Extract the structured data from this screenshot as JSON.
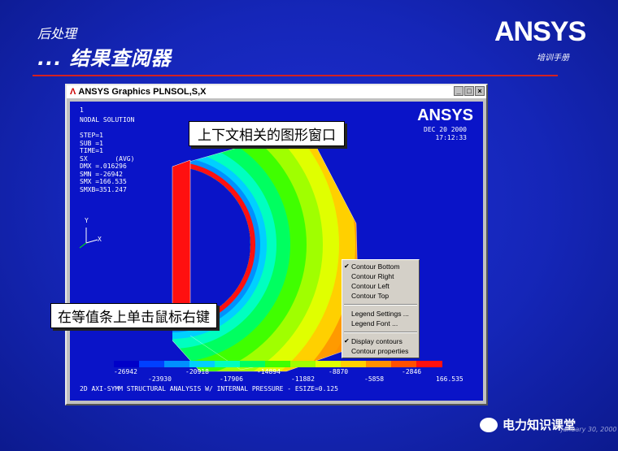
{
  "slide": {
    "subtitle": "后处理",
    "title": "... 结果查阅器",
    "logo": "ANSYS",
    "logo_sub": "培训手册",
    "footer_brand": "电力知识课堂",
    "footer_date": "January 30, 2000"
  },
  "window": {
    "title": "ANSYS Graphics  PLNSOL,S,X",
    "btn_min": "_",
    "btn_max": "□",
    "btn_close": "×"
  },
  "canvas": {
    "window_number": "1",
    "info_lines": "NODAL SOLUTION\n\nSTEP=1\nSUB =1\nTIME=1\nSX       (AVG)\nDMX =.016296\nSMN =-26942\nSMX =166.535\nSMXB=351.247",
    "ansys_mark": "ANSYS",
    "date": "DEC 20 2000\n17:12:33",
    "axis_y": "Y",
    "axis_x": "X",
    "bottom_text": "2D AXI-SYMM STRUCTURAL ANALYSIS W/ INTERNAL PRESSURE - ESIZE=0.125"
  },
  "callouts": {
    "context_window": "上下文相关的图形窗口",
    "right_click": "在等值条上单击鼠标右键"
  },
  "context_menu": {
    "items": [
      {
        "label": "Contour Bottom",
        "checked": true
      },
      {
        "label": "Contour Right",
        "checked": false
      },
      {
        "label": "Contour Left",
        "checked": false
      },
      {
        "label": "Contour Top",
        "checked": false
      },
      {
        "label": "Legend Settings ...",
        "checked": false
      },
      {
        "label": "Legend Font ...",
        "checked": false
      },
      {
        "label": "Display contours",
        "checked": true
      },
      {
        "label": "Contour properties",
        "checked": false
      }
    ],
    "check_glyph": "✔"
  },
  "legend": {
    "colors": [
      "#0000c8",
      "#0040ff",
      "#0090ff",
      "#00d0ff",
      "#00ffc0",
      "#00ff60",
      "#40ff00",
      "#a0ff00",
      "#e0ff00",
      "#ffd000",
      "#ff9000",
      "#ff5000",
      "#ff1010"
    ],
    "labels_top": [
      "-26942",
      "-20918",
      "-14894",
      "-8870",
      "-2846"
    ],
    "labels_bottom": [
      "-23930",
      "-17906",
      "-11882",
      "-5858",
      "166.535"
    ]
  }
}
